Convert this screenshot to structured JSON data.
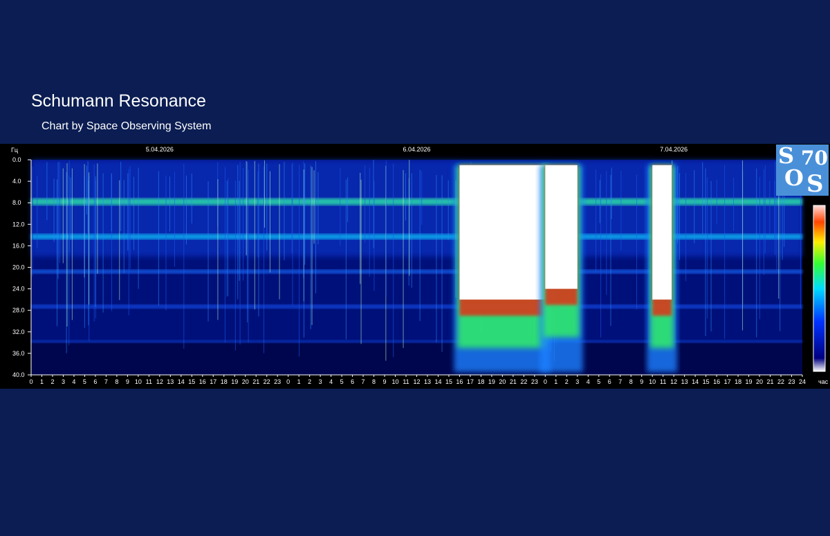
{
  "header": {
    "title": "Schumann Resonance",
    "subtitle": "Chart by Space Observing System"
  },
  "logo": {
    "letters": [
      "S",
      "70",
      "O",
      "S"
    ],
    "background": "#4a90d9"
  },
  "colors": {
    "page_background": "#0b1d52",
    "chart_background": "#000000",
    "axis_text": "#ffffff"
  },
  "chart_data": {
    "type": "heatmap",
    "ylabel": "Гц",
    "xlabel": "час",
    "y_ticks": [
      "0.0",
      "4.0",
      "8.0",
      "12.0",
      "16.0",
      "20.0",
      "24.0",
      "28.0",
      "32.0",
      "36.0",
      "40.0"
    ],
    "ylim": [
      0,
      40
    ],
    "y_axis_direction": "down",
    "x_ticks": [
      "0",
      "1",
      "2",
      "3",
      "4",
      "5",
      "6",
      "7",
      "8",
      "9",
      "10",
      "11",
      "12",
      "13",
      "14",
      "15",
      "16",
      "17",
      "18",
      "19",
      "20",
      "21",
      "22",
      "23",
      "0",
      "1",
      "2",
      "3",
      "4",
      "5",
      "6",
      "7",
      "8",
      "9",
      "10",
      "11",
      "12",
      "13",
      "14",
      "15",
      "16",
      "17",
      "18",
      "19",
      "20",
      "21",
      "22",
      "23",
      "0",
      "1",
      "2",
      "3",
      "4",
      "5",
      "6",
      "7",
      "8",
      "9",
      "10",
      "11",
      "12",
      "13",
      "14",
      "15",
      "16",
      "17",
      "18",
      "19",
      "20",
      "21",
      "22",
      "23",
      "24"
    ],
    "dates": [
      "5.04.2026",
      "6.04.2026",
      "7.04.2026"
    ],
    "colorscale": [
      "#000033",
      "#0000aa",
      "#0055ff",
      "#00ccff",
      "#33ff99",
      "#ccff00",
      "#ffaa00",
      "#dd2200",
      "#ffffff"
    ],
    "resonance_bands_hz": [
      7.8,
      14.3,
      20.8,
      27.3,
      33.8
    ],
    "intense_events": [
      {
        "start_hour": 40,
        "end_hour": 48,
        "max_frequency_hz": 26
      },
      {
        "start_hour": 48,
        "end_hour": 51,
        "max_frequency_hz": 24
      },
      {
        "start_hour": 58,
        "end_hour": 59.8,
        "max_frequency_hz": 26
      }
    ],
    "grid": false,
    "legend": "colorbar-right"
  }
}
